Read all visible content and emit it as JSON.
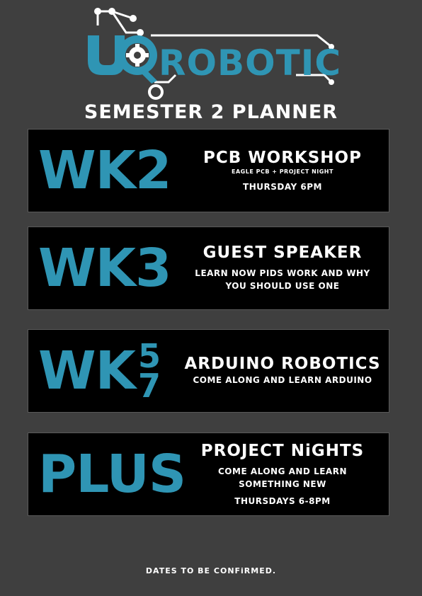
{
  "logo": {
    "letters": "ROBOTICS",
    "accent": "#2f95b4",
    "icon": "gear-icon"
  },
  "subtitle": "SEMESTER 2 PLANNER",
  "cards": [
    {
      "week": "WK2",
      "title": "PCB WORKSHOP",
      "desc1": "EAGLE PCB + PROJECT NIGHT",
      "desc2": "",
      "when": "THURSDAY 6PM"
    },
    {
      "week": "WK3",
      "title": "GUEST SPEAKER",
      "desc1": "LEARN NOW PIDS WORK AND WHY",
      "desc2": "YOU SHOULD USE ONE",
      "when": ""
    },
    {
      "week": "WK",
      "week_top": "5",
      "week_bottom": "7",
      "title": "ARDUINO ROBOTICS",
      "desc1": "COME ALONG AND LEARN ARDUINO",
      "desc2": "",
      "when": ""
    },
    {
      "week": "PLUS",
      "title": "PROJECT NiGHTS",
      "desc1": "COME ALONG AND LEARN",
      "desc2": "SOMETHING NEW",
      "when": "THURSDAYS 6-8PM"
    }
  ],
  "footer": "DATES TO BE CONFiRMED."
}
